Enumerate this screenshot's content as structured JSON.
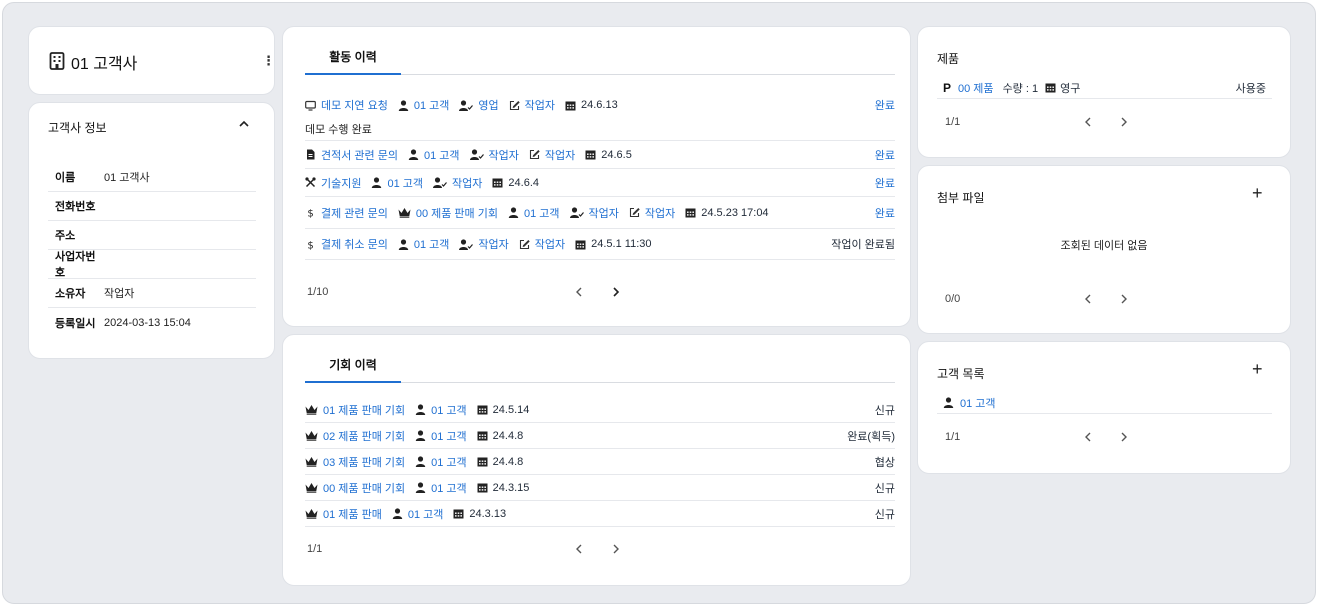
{
  "company": {
    "name": "01 고객사"
  },
  "info": {
    "title": "고객사 정보",
    "rows": [
      {
        "key": "이름",
        "value": "01 고객사",
        "link": false
      },
      {
        "key": "전화번호",
        "value": "",
        "link": false
      },
      {
        "key": "주소",
        "value": "",
        "link": false
      },
      {
        "key": "사업자번호",
        "value": "",
        "link": false
      },
      {
        "key": "소유자",
        "value": "작업자",
        "link": true
      },
      {
        "key": "등록일시",
        "value": "2024-03-13 15:04",
        "link": false
      }
    ]
  },
  "activity": {
    "tab": "활동 이력",
    "note": "데모 수행 완료",
    "rows": [
      {
        "icon": "monitor-icon",
        "title": "데모 지연 요청",
        "customer": "01 고객",
        "assignee": "영업",
        "writer": "작업자",
        "date": "24.6.13",
        "status": "완료"
      },
      {
        "icon": "document-icon",
        "title": "견적서 관련 문의",
        "customer": "01 고객",
        "assignee": "작업자",
        "writer": "작업자",
        "date": "24.6.5",
        "status": "완료"
      },
      {
        "icon": "tools-icon",
        "title": "기술지원",
        "customer": "01 고객",
        "assignee": "작업자",
        "date": "24.6.4",
        "status": "완료"
      },
      {
        "icon": "dollar-icon",
        "title": "결제 관련 문의",
        "opportunity": "00 제품 판매 기회",
        "customer": "01 고객",
        "assignee": "작업자",
        "writer": "작업자",
        "date": "24.5.23 17:04",
        "status": "완료"
      },
      {
        "icon": "dollar-icon",
        "title": "결제 취소 문의",
        "customer": "01 고객",
        "assignee": "작업자",
        "writer": "작업자",
        "date": "24.5.1 11:30",
        "status": "작업이 완료됨"
      }
    ],
    "pager": "1/10"
  },
  "opportunities": {
    "tab": "기회 이력",
    "rows": [
      {
        "title": "01 제품 판매 기회",
        "customer": "01 고객",
        "date": "24.5.14",
        "status": "신규"
      },
      {
        "title": "02 제품 판매 기회",
        "customer": "01 고객",
        "date": "24.4.8",
        "status": "완료(획득)"
      },
      {
        "title": "03 제품 판매 기회",
        "customer": "01 고객",
        "date": "24.4.8",
        "status": "협상"
      },
      {
        "title": "00 제품 판매 기회",
        "customer": "01 고객",
        "date": "24.3.15",
        "status": "신규"
      },
      {
        "title": "01 제품 판매",
        "customer": "01 고객",
        "date": "24.3.13",
        "status": "신규"
      }
    ],
    "pager": "1/1"
  },
  "products": {
    "title": "제품",
    "item": {
      "badge": "P",
      "name": "00 제품",
      "qty": "수량 : 1",
      "term": "영구",
      "status": "사용중"
    },
    "pager": "1/1"
  },
  "attachments": {
    "title": "첨부 파일",
    "empty": "조회된 데이터 없음",
    "pager": "0/0"
  },
  "customers": {
    "title": "고객 목록",
    "item": "01 고객",
    "pager": "1/1"
  },
  "colors": {
    "accent": "#1f6fd1",
    "background": "#e9ebef"
  }
}
